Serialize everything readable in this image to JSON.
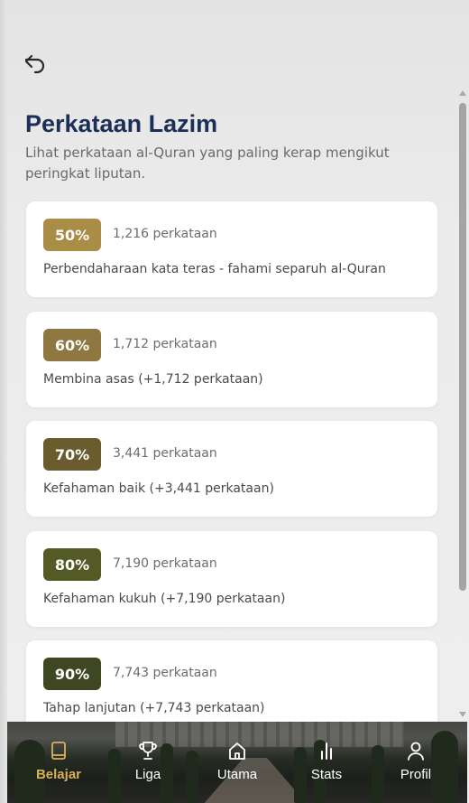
{
  "header": {
    "back_icon": "back-arrow-icon"
  },
  "page": {
    "title": "Perkataan Lazim",
    "subtitle": "Lihat perkataan al-Quran yang paling kerap mengikut peringkat liputan."
  },
  "levels": [
    {
      "percent": "50%",
      "count": "1,216 perkataan",
      "description": "Perbendaharaan kata teras - fahami separuh al-Quran",
      "color": "#a98c45"
    },
    {
      "percent": "60%",
      "count": "1,712 perkataan",
      "description": "Membina asas (+1,712 perkataan)",
      "color": "#8f7741"
    },
    {
      "percent": "70%",
      "count": "3,441 perkataan",
      "description": "Kefahaman baik (+3,441 perkataan)",
      "color": "#6b5c2e"
    },
    {
      "percent": "80%",
      "count": "7,190 perkataan",
      "description": "Kefahaman kukuh (+7,190 perkataan)",
      "color": "#545a26"
    },
    {
      "percent": "90%",
      "count": "7,743 perkataan",
      "description": "Tahap lanjutan (+7,743 perkataan)",
      "color": "#3f4722"
    }
  ],
  "bottom_nav": {
    "active_color": "#d8b05a",
    "items": [
      {
        "label": "Belajar",
        "icon": "book-icon",
        "active": true
      },
      {
        "label": "Liga",
        "icon": "trophy-icon",
        "active": false
      },
      {
        "label": "Utama",
        "icon": "home-icon",
        "active": false
      },
      {
        "label": "Stats",
        "icon": "bar-chart-icon",
        "active": false
      },
      {
        "label": "Profil",
        "icon": "user-icon",
        "active": false
      }
    ]
  }
}
